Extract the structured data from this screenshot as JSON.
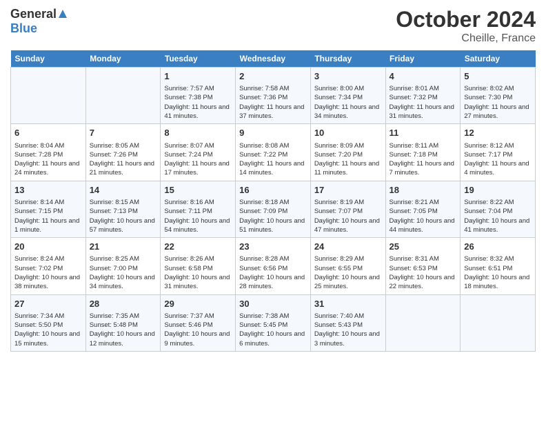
{
  "logo": {
    "general": "General",
    "blue": "Blue"
  },
  "title": "October 2024",
  "location": "Cheille, France",
  "days_of_week": [
    "Sunday",
    "Monday",
    "Tuesday",
    "Wednesday",
    "Thursday",
    "Friday",
    "Saturday"
  ],
  "weeks": [
    [
      {
        "day": "",
        "empty": true
      },
      {
        "day": "",
        "empty": true
      },
      {
        "day": "1",
        "sunrise": "Sunrise: 7:57 AM",
        "sunset": "Sunset: 7:38 PM",
        "daylight": "Daylight: 11 hours and 41 minutes."
      },
      {
        "day": "2",
        "sunrise": "Sunrise: 7:58 AM",
        "sunset": "Sunset: 7:36 PM",
        "daylight": "Daylight: 11 hours and 37 minutes."
      },
      {
        "day": "3",
        "sunrise": "Sunrise: 8:00 AM",
        "sunset": "Sunset: 7:34 PM",
        "daylight": "Daylight: 11 hours and 34 minutes."
      },
      {
        "day": "4",
        "sunrise": "Sunrise: 8:01 AM",
        "sunset": "Sunset: 7:32 PM",
        "daylight": "Daylight: 11 hours and 31 minutes."
      },
      {
        "day": "5",
        "sunrise": "Sunrise: 8:02 AM",
        "sunset": "Sunset: 7:30 PM",
        "daylight": "Daylight: 11 hours and 27 minutes."
      }
    ],
    [
      {
        "day": "6",
        "sunrise": "Sunrise: 8:04 AM",
        "sunset": "Sunset: 7:28 PM",
        "daylight": "Daylight: 11 hours and 24 minutes."
      },
      {
        "day": "7",
        "sunrise": "Sunrise: 8:05 AM",
        "sunset": "Sunset: 7:26 PM",
        "daylight": "Daylight: 11 hours and 21 minutes."
      },
      {
        "day": "8",
        "sunrise": "Sunrise: 8:07 AM",
        "sunset": "Sunset: 7:24 PM",
        "daylight": "Daylight: 11 hours and 17 minutes."
      },
      {
        "day": "9",
        "sunrise": "Sunrise: 8:08 AM",
        "sunset": "Sunset: 7:22 PM",
        "daylight": "Daylight: 11 hours and 14 minutes."
      },
      {
        "day": "10",
        "sunrise": "Sunrise: 8:09 AM",
        "sunset": "Sunset: 7:20 PM",
        "daylight": "Daylight: 11 hours and 11 minutes."
      },
      {
        "day": "11",
        "sunrise": "Sunrise: 8:11 AM",
        "sunset": "Sunset: 7:18 PM",
        "daylight": "Daylight: 11 hours and 7 minutes."
      },
      {
        "day": "12",
        "sunrise": "Sunrise: 8:12 AM",
        "sunset": "Sunset: 7:17 PM",
        "daylight": "Daylight: 11 hours and 4 minutes."
      }
    ],
    [
      {
        "day": "13",
        "sunrise": "Sunrise: 8:14 AM",
        "sunset": "Sunset: 7:15 PM",
        "daylight": "Daylight: 11 hours and 1 minute."
      },
      {
        "day": "14",
        "sunrise": "Sunrise: 8:15 AM",
        "sunset": "Sunset: 7:13 PM",
        "daylight": "Daylight: 10 hours and 57 minutes."
      },
      {
        "day": "15",
        "sunrise": "Sunrise: 8:16 AM",
        "sunset": "Sunset: 7:11 PM",
        "daylight": "Daylight: 10 hours and 54 minutes."
      },
      {
        "day": "16",
        "sunrise": "Sunrise: 8:18 AM",
        "sunset": "Sunset: 7:09 PM",
        "daylight": "Daylight: 10 hours and 51 minutes."
      },
      {
        "day": "17",
        "sunrise": "Sunrise: 8:19 AM",
        "sunset": "Sunset: 7:07 PM",
        "daylight": "Daylight: 10 hours and 47 minutes."
      },
      {
        "day": "18",
        "sunrise": "Sunrise: 8:21 AM",
        "sunset": "Sunset: 7:05 PM",
        "daylight": "Daylight: 10 hours and 44 minutes."
      },
      {
        "day": "19",
        "sunrise": "Sunrise: 8:22 AM",
        "sunset": "Sunset: 7:04 PM",
        "daylight": "Daylight: 10 hours and 41 minutes."
      }
    ],
    [
      {
        "day": "20",
        "sunrise": "Sunrise: 8:24 AM",
        "sunset": "Sunset: 7:02 PM",
        "daylight": "Daylight: 10 hours and 38 minutes."
      },
      {
        "day": "21",
        "sunrise": "Sunrise: 8:25 AM",
        "sunset": "Sunset: 7:00 PM",
        "daylight": "Daylight: 10 hours and 34 minutes."
      },
      {
        "day": "22",
        "sunrise": "Sunrise: 8:26 AM",
        "sunset": "Sunset: 6:58 PM",
        "daylight": "Daylight: 10 hours and 31 minutes."
      },
      {
        "day": "23",
        "sunrise": "Sunrise: 8:28 AM",
        "sunset": "Sunset: 6:56 PM",
        "daylight": "Daylight: 10 hours and 28 minutes."
      },
      {
        "day": "24",
        "sunrise": "Sunrise: 8:29 AM",
        "sunset": "Sunset: 6:55 PM",
        "daylight": "Daylight: 10 hours and 25 minutes."
      },
      {
        "day": "25",
        "sunrise": "Sunrise: 8:31 AM",
        "sunset": "Sunset: 6:53 PM",
        "daylight": "Daylight: 10 hours and 22 minutes."
      },
      {
        "day": "26",
        "sunrise": "Sunrise: 8:32 AM",
        "sunset": "Sunset: 6:51 PM",
        "daylight": "Daylight: 10 hours and 18 minutes."
      }
    ],
    [
      {
        "day": "27",
        "sunrise": "Sunrise: 7:34 AM",
        "sunset": "Sunset: 5:50 PM",
        "daylight": "Daylight: 10 hours and 15 minutes."
      },
      {
        "day": "28",
        "sunrise": "Sunrise: 7:35 AM",
        "sunset": "Sunset: 5:48 PM",
        "daylight": "Daylight: 10 hours and 12 minutes."
      },
      {
        "day": "29",
        "sunrise": "Sunrise: 7:37 AM",
        "sunset": "Sunset: 5:46 PM",
        "daylight": "Daylight: 10 hours and 9 minutes."
      },
      {
        "day": "30",
        "sunrise": "Sunrise: 7:38 AM",
        "sunset": "Sunset: 5:45 PM",
        "daylight": "Daylight: 10 hours and 6 minutes."
      },
      {
        "day": "31",
        "sunrise": "Sunrise: 7:40 AM",
        "sunset": "Sunset: 5:43 PM",
        "daylight": "Daylight: 10 hours and 3 minutes."
      },
      {
        "day": "",
        "empty": true
      },
      {
        "day": "",
        "empty": true
      }
    ]
  ]
}
